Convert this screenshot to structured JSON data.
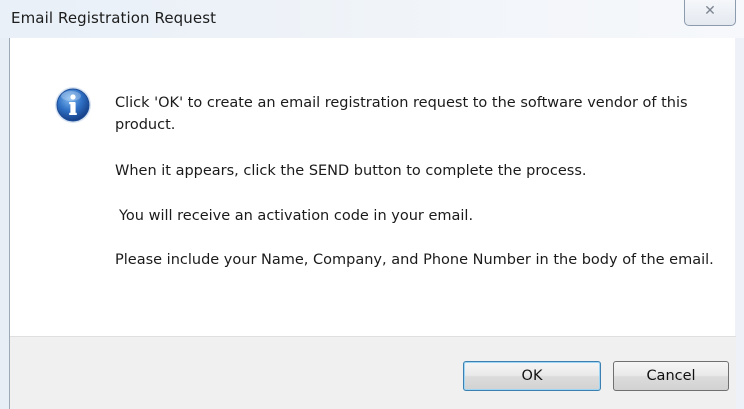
{
  "window": {
    "title": "Email Registration Request",
    "close_glyph": "✕"
  },
  "dialog": {
    "icon": "information-icon",
    "messages": [
      "Click 'OK' to create an email registration request to the software vendor of this product.",
      "When it appears, click the SEND button to complete the process.",
      "You will receive an activation code in your email.",
      "Please include your Name, Company, and Phone Number in the body of the email."
    ]
  },
  "buttons": {
    "ok_label": "OK",
    "cancel_label": "Cancel"
  },
  "colors": {
    "icon_blue": "#2a6cc0",
    "default_button_border": "#3c7fb1"
  }
}
